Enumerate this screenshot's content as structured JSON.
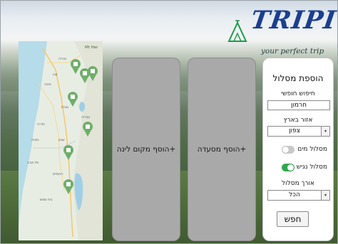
{
  "brand": {
    "name": "TRIPI",
    "tagline": "your perfect trip",
    "color": "#1b3f8f",
    "tent_color": "#1e9a4c"
  },
  "map": {
    "labels": [
      {
        "id": "top",
        "text": "Mt Her"
      },
      {
        "id": "n1",
        "text": "נהריה"
      },
      {
        "id": "n2",
        "text": "עכו"
      },
      {
        "id": "n3",
        "text": "חיפה"
      },
      {
        "id": "n4",
        "text": "נצרת"
      },
      {
        "id": "n5",
        "text": "טבריה"
      },
      {
        "id": "n6",
        "text": "חדרה"
      },
      {
        "id": "n7",
        "text": "נתניה"
      },
      {
        "id": "n8",
        "text": "שכם"
      },
      {
        "id": "n9",
        "text": "תל אביב"
      },
      {
        "id": "n10",
        "text": "ירושלים"
      },
      {
        "id": "n11",
        "text": "בית שמש"
      }
    ],
    "marker_icon": "map-pin-icon",
    "marker_color": "#6fae6a"
  },
  "panels": {
    "lodging_label": "+הוסף מקום לינה",
    "restaurant_label": "+הוסף מסעדה"
  },
  "form": {
    "title": "הוספת מסלול",
    "free_search_label": "חיפוש חופשי",
    "free_search_value": "חרמון",
    "region_label": "אזור בארץ",
    "region_value": "צפון",
    "water_label": "מסלול מים",
    "water_on": false,
    "accessible_label": "מסלול נגיש",
    "accessible_on": true,
    "length_label": "אורך מסלול",
    "length_value": "הכל",
    "search_button": "חפש"
  }
}
